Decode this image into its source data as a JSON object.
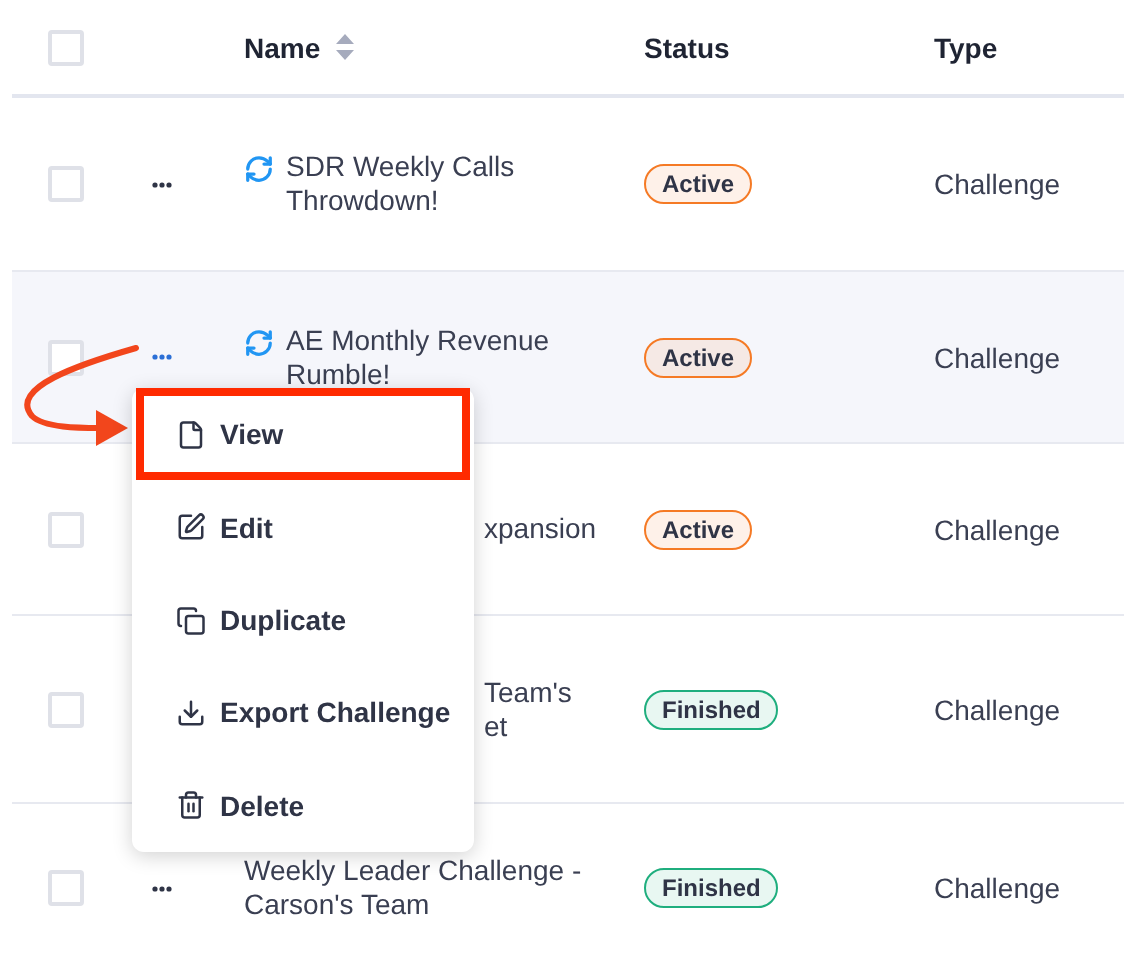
{
  "table": {
    "select_all": {
      "checked": false
    },
    "columns": [
      {
        "label": "Name",
        "sortable": true
      },
      {
        "label": "Status",
        "sortable": false
      },
      {
        "label": "Type",
        "sortable": false
      }
    ],
    "rows": [
      {
        "checked": false,
        "name_lines": [
          "SDR Weekly Calls",
          "Throwdown!"
        ],
        "recurring": true,
        "status": "Active",
        "color": "#f57a25",
        "type": "Challenge",
        "hovered": false,
        "covered": false
      },
      {
        "checked": false,
        "name_lines": [
          "AE Monthly Revenue",
          "Rumble!"
        ],
        "recurring": true,
        "status": "Active",
        "color": "#f57a25",
        "type": "Challenge",
        "hovered": true,
        "covered": false
      },
      {
        "checked": false,
        "name_lines": [
          "xpansion"
        ],
        "recurring": false,
        "status": "Active",
        "color": "#f57a25",
        "type": "Challenge",
        "hovered": false,
        "covered": true
      },
      {
        "checked": false,
        "name_lines": [
          "Team's",
          "et"
        ],
        "recurring": false,
        "status": "Finished",
        "color": "#1fae7e",
        "type": "Challenge",
        "hovered": false,
        "covered": true
      },
      {
        "checked": false,
        "name_lines": [
          "Weekly Leader Challenge -",
          "Carson's Team"
        ],
        "recurring": false,
        "status": "Finished",
        "color": "#1fae7e",
        "type": "Challenge",
        "hovered": false,
        "covered": false
      }
    ]
  },
  "menu": {
    "items": [
      {
        "label": "View",
        "kind": "view",
        "highlighted": true
      },
      {
        "label": "Edit",
        "kind": "edit",
        "highlighted": false
      },
      {
        "label": "Duplicate",
        "kind": "duplicate",
        "highlighted": false
      },
      {
        "label": "Export Challenge",
        "kind": "export",
        "highlighted": false
      },
      {
        "label": "Delete",
        "kind": "delete",
        "highlighted": false
      }
    ]
  }
}
